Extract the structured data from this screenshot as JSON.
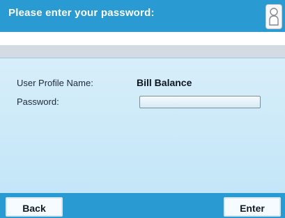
{
  "header": {
    "title": "Please enter your password:"
  },
  "form": {
    "user_profile_label": "User Profile Name:",
    "user_profile_value": "Bill Balance",
    "password_label": "Password:"
  },
  "footer": {
    "back_label": "Back",
    "enter_label": "Enter"
  },
  "icons": {
    "profile_icon": "user-profile-icon"
  },
  "colors": {
    "header_blue": "#2a9ad3",
    "content_light_blue": "#c3e6f8",
    "button_bg": "#f6fbff"
  }
}
